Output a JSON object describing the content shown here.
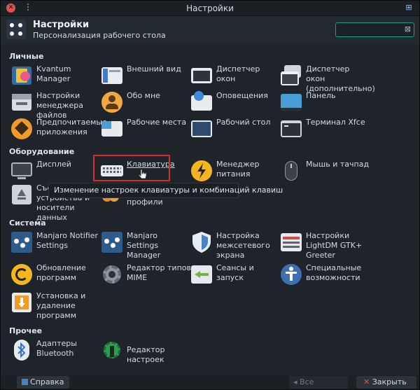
{
  "window": {
    "title": "Настройки",
    "close_glyph": "✕",
    "menu_glyph": "⋮",
    "shade_glyph": "⊞"
  },
  "header": {
    "title": "Настройки",
    "subtitle": "Персонализация рабочего стола",
    "search_placeholder": "",
    "clear_glyph": "⊠"
  },
  "sections": {
    "personal": "Личные",
    "hardware": "Оборудование",
    "system": "Система",
    "other": "Прочее"
  },
  "personal": [
    {
      "label": "Kvantum Manager",
      "icon": "kvantum-icon"
    },
    {
      "label": "Внешний вид",
      "icon": "appearance-icon"
    },
    {
      "label": "Диспетчер окон",
      "icon": "window-manager-icon"
    },
    {
      "label": "Диспетчер окон (дополнительно)",
      "icon": "window-manager-tweaks-icon"
    },
    {
      "label": "Настройки менеджера файлов",
      "icon": "file-manager-icon"
    },
    {
      "label": "Обо мне",
      "icon": "about-me-icon"
    },
    {
      "label": "Оповещения",
      "icon": "notifications-icon"
    },
    {
      "label": "Панель",
      "icon": "panel-icon"
    },
    {
      "label": "Предпочитаемые приложения",
      "icon": "preferred-apps-icon"
    },
    {
      "label": "Рабочие места",
      "icon": "workspaces-icon"
    },
    {
      "label": "Рабочий стол",
      "icon": "desktop-icon"
    },
    {
      "label": "Терминал Xfce",
      "icon": "terminal-icon"
    }
  ],
  "hardware": [
    {
      "label": "Дисплей",
      "icon": "display-icon"
    },
    {
      "label": "Клавиатура",
      "icon": "keyboard-icon"
    },
    {
      "label": "Менеджер питания",
      "icon": "power-manager-icon"
    },
    {
      "label": "Мышь и тачпад",
      "icon": "mouse-icon"
    },
    {
      "label": "Съемные устройства и носители данных",
      "icon": "removable-drives-icon"
    },
    {
      "label": "профили",
      "icon": "color-profiles-icon"
    }
  ],
  "tooltip": "Изменение настроек клавиатуры и комбинаций клавиш",
  "system": [
    {
      "label": "Manjaro Notifier Settings",
      "icon": "manjaro-notifier-icon"
    },
    {
      "label": "Manjaro Settings Manager",
      "icon": "manjaro-settings-icon"
    },
    {
      "label": "Настройка межсетевого экрана",
      "icon": "firewall-icon"
    },
    {
      "label": "Настройки LightDM GTK+ Greeter",
      "icon": "lightdm-icon"
    },
    {
      "label": "Обновление программ",
      "icon": "software-update-icon"
    },
    {
      "label": "Редактор типов MIME",
      "icon": "mime-editor-icon"
    },
    {
      "label": "Сеансы и запуск",
      "icon": "sessions-icon"
    },
    {
      "label": "Специальные возможности",
      "icon": "accessibility-icon"
    },
    {
      "label": "Установка и удаление программ",
      "icon": "add-remove-software-icon"
    }
  ],
  "other": [
    {
      "label": "Адаптеры Bluetooth",
      "icon": "bluetooth-icon"
    },
    {
      "label": "Редактор настроек",
      "icon": "settings-editor-icon"
    }
  ],
  "footer": {
    "help": "Справка",
    "all_settings": "Все настройки",
    "close": "Закрыть"
  },
  "colors": {
    "accent": "#16a085",
    "highlight": "#d82a2a",
    "manjaro": "#2d5b8c"
  }
}
